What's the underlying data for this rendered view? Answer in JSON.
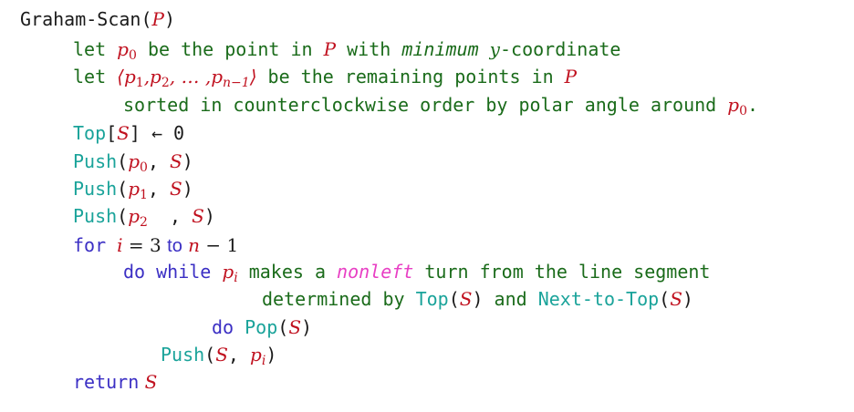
{
  "algorithm": {
    "name": "Graham-Scan",
    "param": "P",
    "lines": {
      "l1": {
        "kw": "let",
        "var": "p",
        "sub": "0",
        "t1": " be the point in ",
        "set": "P",
        "t2": " with ",
        "em": "minimum",
        "y": "y",
        "t3": "-coordinate"
      },
      "l2": {
        "kw": "let",
        "seq": "⟨p",
        "s1": "1",
        "c1": ",p",
        "s2": "2",
        "c2": ", … ,p",
        "s3": "n−1",
        "close": "⟩",
        "t1": " be the remaining points in ",
        "set": "P"
      },
      "l3": {
        "t1": "sorted in counterclockwise order by polar angle around ",
        "var": "p",
        "sub": "0",
        "dot": "."
      },
      "l4": {
        "top": "Top",
        "lb": "[",
        "s": "S",
        "rb": "]",
        "arrow": " ← ",
        "zero": "0"
      },
      "l5": {
        "fn": "Push",
        "op": "(",
        "var": "p",
        "sub": "0",
        "comma": ", ",
        "s": "S",
        "cp": ")"
      },
      "l6": {
        "fn": "Push",
        "op": "(",
        "var": "p",
        "sub": "1",
        "comma": ", ",
        "s": "S",
        "cp": ")"
      },
      "l7": {
        "fn": "Push",
        "op": "(",
        "var": "p",
        "sub": "2",
        "comma": "  , ",
        "s": "S",
        "cp": ")"
      },
      "l8": {
        "kw": "for",
        "i": "i",
        "eq": " = 3 ",
        "to": "to",
        "n": " n",
        "rest": " − 1"
      },
      "l9": {
        "kw": "do while",
        "var": "p",
        "sub": "i",
        "t1": " makes a ",
        "em": "nonleft",
        "t2": " turn from the line segment"
      },
      "l10": {
        "t1": "determined by ",
        "top": "Top",
        "op1": "(",
        "s1": "S",
        "cp1": ")",
        "and": " and ",
        "nt": "Next-to-Top",
        "op2": "(",
        "s2": "S",
        "cp2": ")"
      },
      "l11": {
        "kw": "do",
        "fn": " Pop",
        "op": "(",
        "s": "S",
        "cp": ")"
      },
      "l12": {
        "fn": "Push",
        "op": "(",
        "s": "S",
        "comma": ", ",
        "var": "p",
        "sub": "i",
        "cp": ")"
      },
      "l13": {
        "kw": "return",
        "s": " S"
      }
    }
  }
}
